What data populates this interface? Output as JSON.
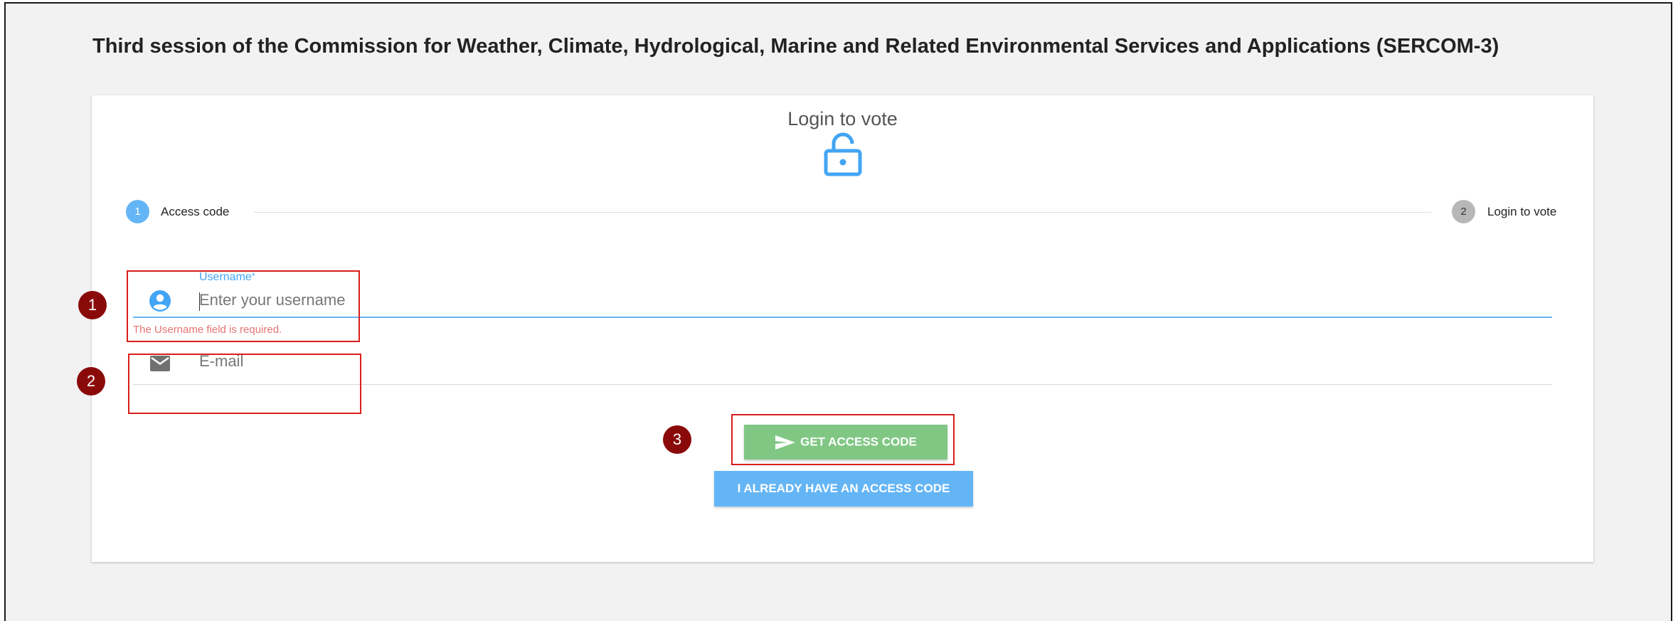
{
  "page": {
    "title": "Third session of the Commission for Weather, Climate, Hydrological, Marine and Related Environmental Services and Applications (SERCOM-3)"
  },
  "login": {
    "heading": "Login to vote",
    "icon": "lock-open-icon"
  },
  "stepper": {
    "steps": [
      {
        "number": "1",
        "label": "Access code",
        "active": true
      },
      {
        "number": "2",
        "label": "Login to vote",
        "active": false
      }
    ]
  },
  "form": {
    "username": {
      "label": "Username",
      "required_mark": "*",
      "placeholder": "Enter your username",
      "value": "",
      "error": "The Username field is required.",
      "icon": "account-circle-icon"
    },
    "email": {
      "placeholder": "E-mail",
      "value": "",
      "icon": "envelope-icon"
    }
  },
  "buttons": {
    "get_access_code": "GET ACCESS CODE",
    "already_have_code": "I ALREADY HAVE AN ACCESS CODE"
  },
  "annotations": [
    "1",
    "2",
    "3"
  ],
  "colors": {
    "accent_blue": "#64b5f6",
    "button_green": "#81c784",
    "error_red": "#e57373",
    "annotation_red": "#d81e1e",
    "badge_maroon": "#8a0a0a"
  }
}
